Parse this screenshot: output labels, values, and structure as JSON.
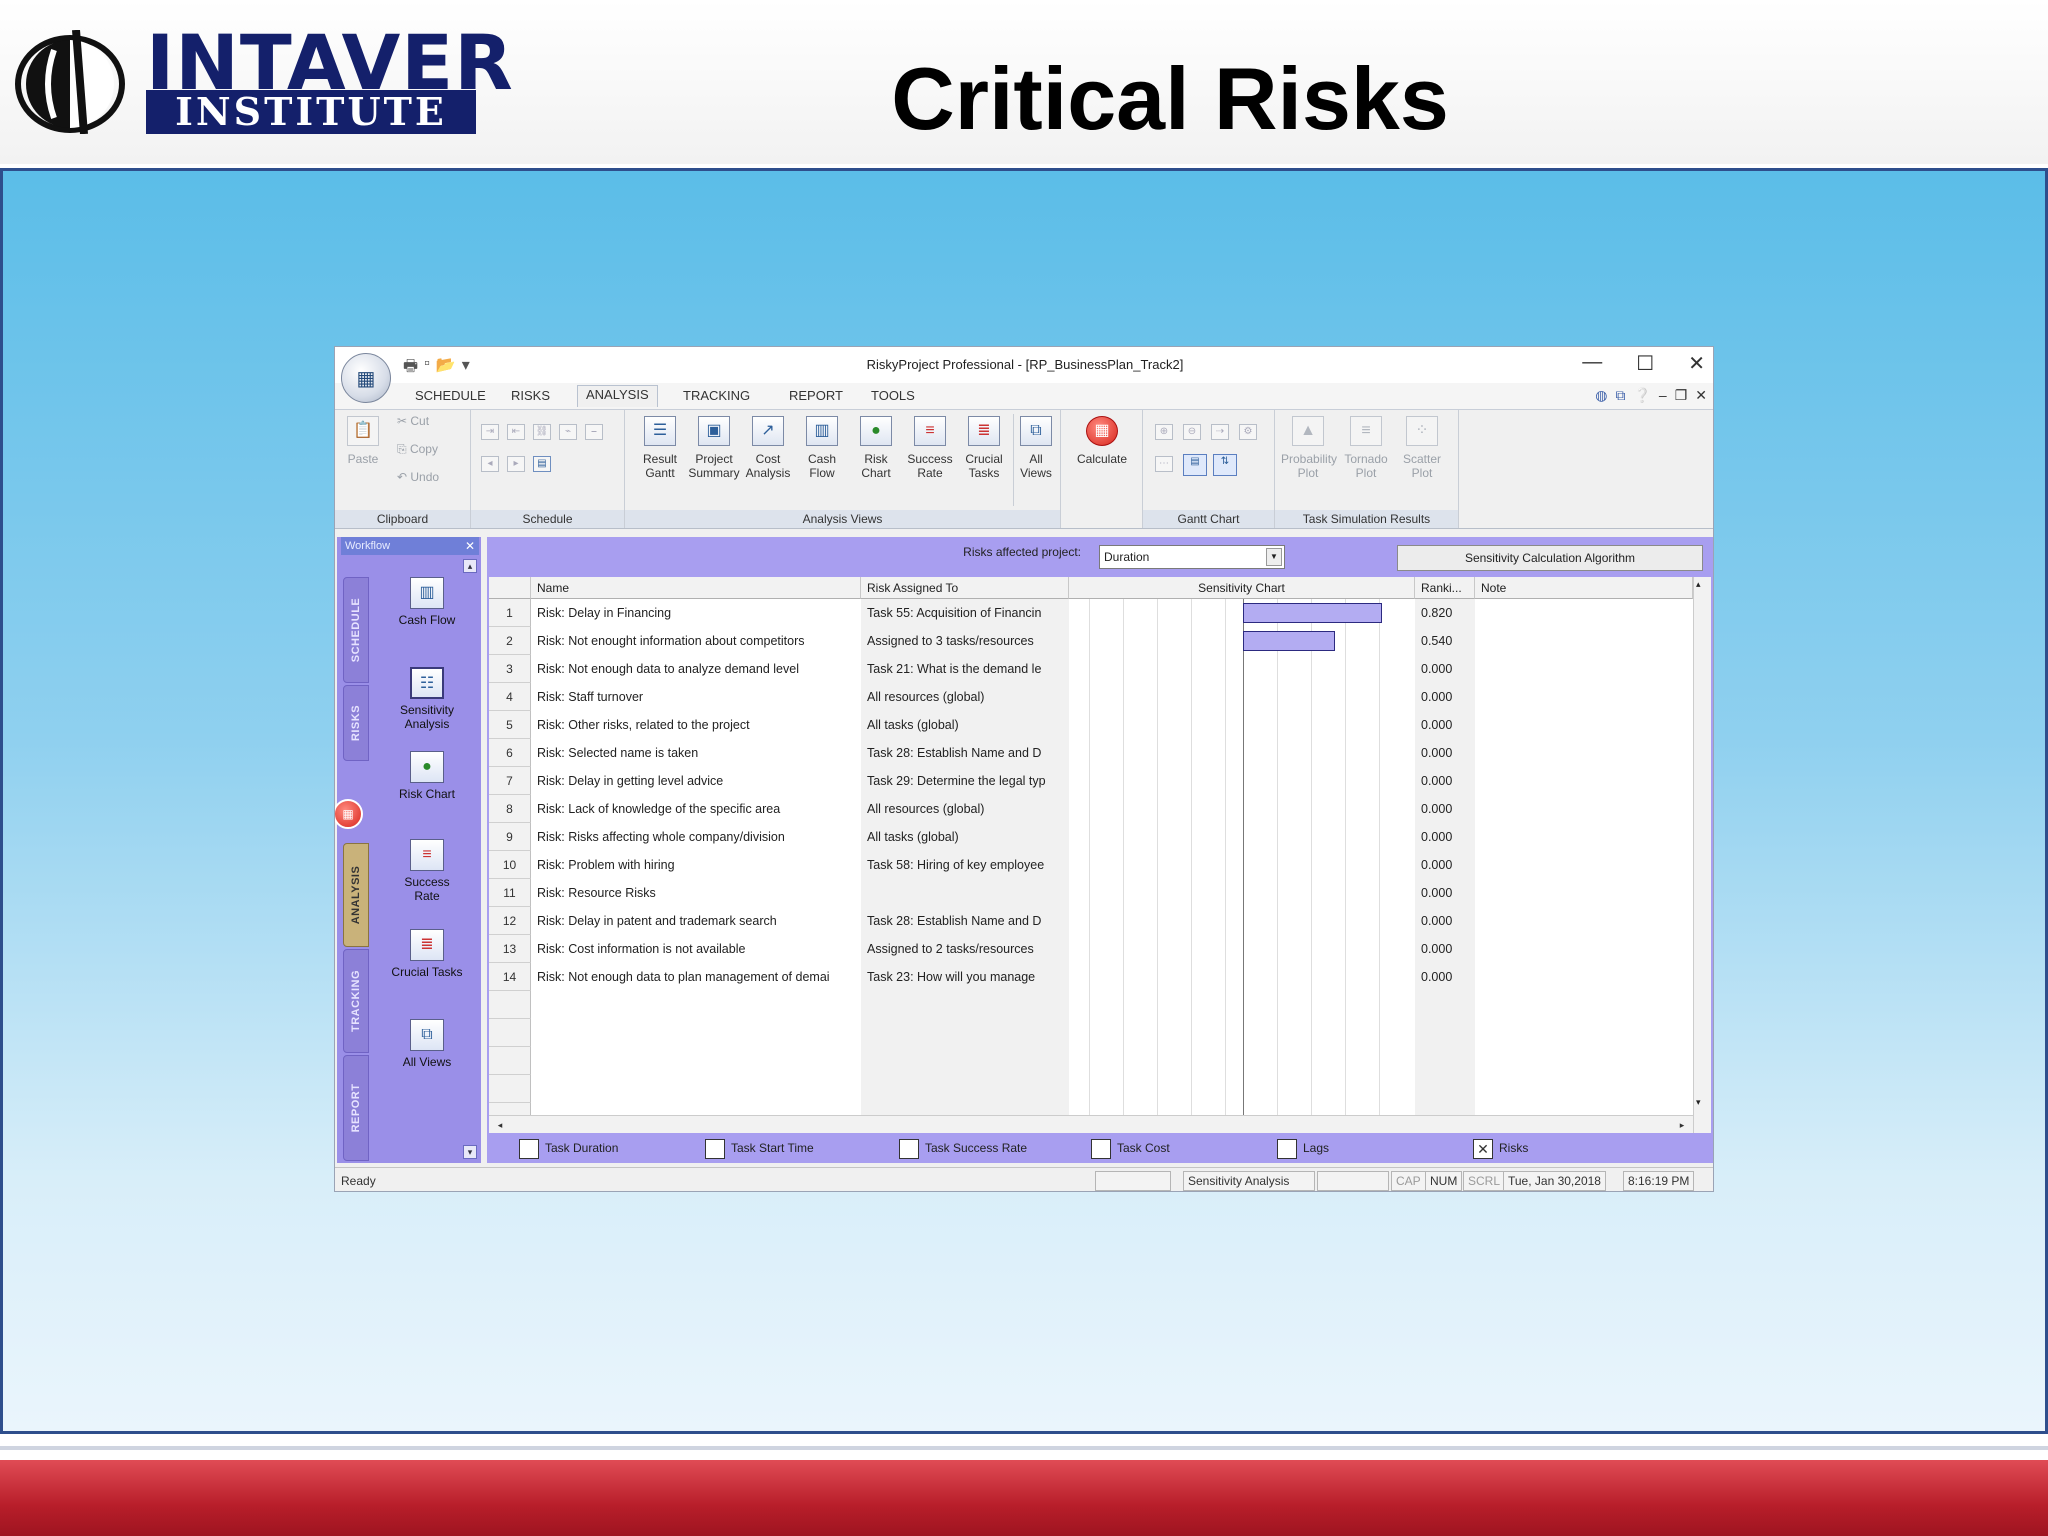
{
  "slide": {
    "logo_top": "INTAVER",
    "logo_bottom": "INSTITUTE",
    "title": "Critical Risks"
  },
  "window": {
    "title": "RiskyProject Professional - [RP_BusinessPlan_Track2]",
    "min_glyph": "—",
    "max_glyph": "☐",
    "close_glyph": "✕"
  },
  "menu_tabs": [
    "SCHEDULE",
    "RISKS",
    "ANALYSIS",
    "TRACKING",
    "REPORT",
    "TOOLS"
  ],
  "ribbon": {
    "clipboard": {
      "paste": "Paste",
      "cut": "Cut",
      "copy": "Copy",
      "undo": "Undo",
      "label": "Clipboard"
    },
    "schedule": {
      "label": "Schedule"
    },
    "analysis_views": {
      "label": "Analysis Views",
      "buttons": [
        {
          "l1": "Result",
          "l2": "Gantt"
        },
        {
          "l1": "Project",
          "l2": "Summary"
        },
        {
          "l1": "Cost",
          "l2": "Analysis"
        },
        {
          "l1": "Cash",
          "l2": "Flow"
        },
        {
          "l1": "Risk",
          "l2": "Chart"
        },
        {
          "l1": "Success",
          "l2": "Rate"
        },
        {
          "l1": "Crucial",
          "l2": "Tasks"
        }
      ],
      "all_views": {
        "l1": "All",
        "l2": "Views"
      }
    },
    "calculate": "Calculate",
    "gantt_chart": {
      "label": "Gantt Chart"
    },
    "task_sim": {
      "label": "Task Simulation Results",
      "buttons": [
        {
          "l1": "Probability",
          "l2": "Plot"
        },
        {
          "l1": "Tornado",
          "l2": "Plot"
        },
        {
          "l1": "Scatter",
          "l2": "Plot"
        }
      ]
    }
  },
  "workflow": {
    "title": "Workflow",
    "tabs": [
      "SCHEDULE",
      "RISKS",
      "ANALYSIS",
      "TRACKING",
      "REPORT"
    ],
    "items": [
      {
        "l1": "Cash Flow",
        "l2": ""
      },
      {
        "l1": "Sensitivity",
        "l2": "Analysis"
      },
      {
        "l1": "Risk Chart",
        "l2": ""
      },
      {
        "l1": "Success",
        "l2": "Rate"
      },
      {
        "l1": "Crucial Tasks",
        "l2": ""
      },
      {
        "l1": "All Views",
        "l2": ""
      }
    ]
  },
  "filter": {
    "label": "Risks affected project:",
    "value": "Duration",
    "algorithm_button": "Sensitivity Calculation Algorithm"
  },
  "grid": {
    "headers": {
      "name": "Name",
      "assigned": "Risk Assigned To",
      "chart": "Sensitivity Chart",
      "rank": "Ranki...",
      "note": "Note"
    },
    "rows": [
      {
        "n": "1",
        "name": "Risk: Delay in Financing",
        "assigned": "Task 55: Acquisition of Financin",
        "rank": "0.820",
        "sens": 0.82
      },
      {
        "n": "2",
        "name": "Risk: Not enought information about competitors",
        "assigned": "Assigned to 3 tasks/resources",
        "rank": "0.540",
        "sens": 0.54
      },
      {
        "n": "3",
        "name": "Risk: Not enough data to analyze demand level",
        "assigned": "Task 21: What is the demand le",
        "rank": "0.000",
        "sens": 0
      },
      {
        "n": "4",
        "name": "Risk: Staff turnover",
        "assigned": "All resources (global)",
        "rank": "0.000",
        "sens": 0
      },
      {
        "n": "5",
        "name": "Risk: Other risks, related to the project",
        "assigned": "All tasks (global)",
        "rank": "0.000",
        "sens": 0
      },
      {
        "n": "6",
        "name": "Risk: Selected name is taken",
        "assigned": "Task 28: Establish Name and D",
        "rank": "0.000",
        "sens": 0
      },
      {
        "n": "7",
        "name": "Risk: Delay in getting level advice",
        "assigned": "Task 29: Determine the legal typ",
        "rank": "0.000",
        "sens": 0
      },
      {
        "n": "8",
        "name": "Risk: Lack of knowledge of the specific area",
        "assigned": "All resources (global)",
        "rank": "0.000",
        "sens": 0
      },
      {
        "n": "9",
        "name": "Risk: Risks affecting whole company/division",
        "assigned": "All tasks (global)",
        "rank": "0.000",
        "sens": 0
      },
      {
        "n": "10",
        "name": "Risk: Problem with hiring",
        "assigned": "Task 58: Hiring of key employee",
        "rank": "0.000",
        "sens": 0
      },
      {
        "n": "11",
        "name": "Risk: Resource Risks",
        "assigned": "",
        "rank": "0.000",
        "sens": 0
      },
      {
        "n": "12",
        "name": "Risk: Delay in patent and trademark search",
        "assigned": "Task 28: Establish Name and D",
        "rank": "0.000",
        "sens": 0
      },
      {
        "n": "13",
        "name": "Risk: Cost information is not available",
        "assigned": "Assigned to 2 tasks/resources",
        "rank": "0.000",
        "sens": 0
      },
      {
        "n": "14",
        "name": "Risk: Not enough data to plan management of demai",
        "assigned": "Task 23: How will you manage",
        "rank": "0.000",
        "sens": 0
      }
    ]
  },
  "checkboxes": [
    {
      "label": "Task Duration",
      "checked": false
    },
    {
      "label": "Task Start Time",
      "checked": false
    },
    {
      "label": "Task Success Rate",
      "checked": false
    },
    {
      "label": "Task Cost",
      "checked": false
    },
    {
      "label": "Lags",
      "checked": false
    },
    {
      "label": "Risks",
      "checked": true
    }
  ],
  "status": {
    "ready": "Ready",
    "view": "Sensitivity Analysis",
    "cap": "CAP",
    "num": "NUM",
    "scrl": "SCRL",
    "date": "Tue, Jan 30,2018",
    "time": "8:16:19 PM"
  },
  "colors": {
    "sensitivity_bar": "#b3acf2",
    "panel_purple": "#a89ef0",
    "brand_navy": "#14206b"
  }
}
